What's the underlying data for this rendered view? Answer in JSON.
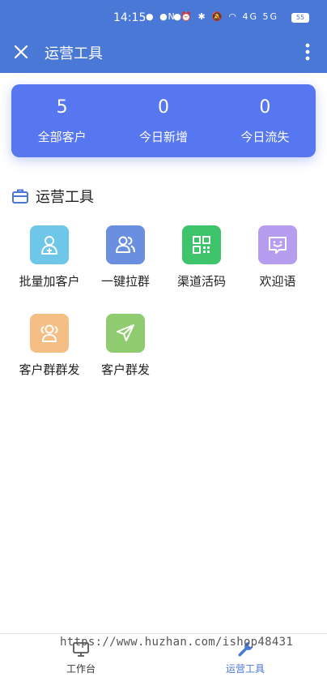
{
  "status_bar": {
    "time": "14:15",
    "battery": "55"
  },
  "header": {
    "title": "运营工具"
  },
  "stats": [
    {
      "value": "5",
      "label": "全部客户"
    },
    {
      "value": "0",
      "label": "今日新增"
    },
    {
      "value": "0",
      "label": "今日流失"
    }
  ],
  "section": {
    "title": "运营工具"
  },
  "tools": [
    {
      "label": "批量加客户",
      "icon": "add-user-icon",
      "color": "#6ec6e8"
    },
    {
      "label": "一键拉群",
      "icon": "group-icon",
      "color": "#6a8fe0"
    },
    {
      "label": "渠道活码",
      "icon": "qr-code-icon",
      "color": "#3ec46a"
    },
    {
      "label": "欢迎语",
      "icon": "chat-smile-icon",
      "color": "#b79df0"
    },
    {
      "label": "客户群群发",
      "icon": "group-broadcast-icon",
      "color": "#f5be85"
    },
    {
      "label": "客户群发",
      "icon": "send-icon",
      "color": "#8fcc6f"
    }
  ],
  "bottom_nav": [
    {
      "label": "工作台",
      "icon": "monitor-icon",
      "active": false
    },
    {
      "label": "运营工具",
      "icon": "wrench-icon",
      "active": true
    }
  ],
  "colors": {
    "header": "#4a78d6",
    "card": "#5677f0",
    "active": "#4a78d6"
  },
  "watermark": "https://www.huzhan.com/ishop48431"
}
